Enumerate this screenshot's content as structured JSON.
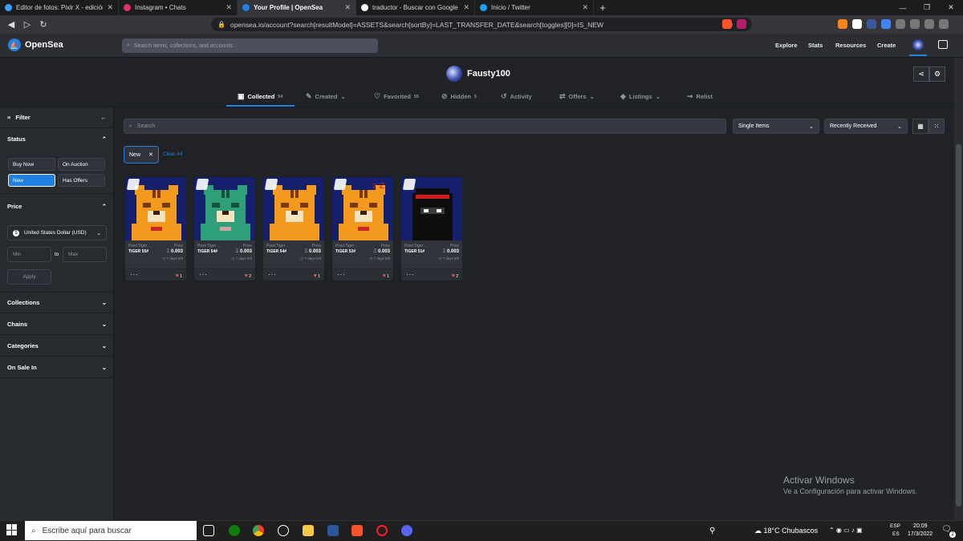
{
  "browser": {
    "tabs": [
      {
        "title": "Editor de fotos: Pixlr X - edición de im",
        "favicon_color": "#3aa0ff"
      },
      {
        "title": "Instagram • Chats",
        "favicon_color": "#e1306c"
      },
      {
        "title": "Your Profile | OpenSea",
        "favicon_color": "#2081e2",
        "active": true
      },
      {
        "title": "traductor - Buscar con Google",
        "favicon_color": "#ffffff"
      },
      {
        "title": "Inicio / Twitter",
        "favicon_color": "#1da1f2"
      }
    ],
    "url": "opensea.io/account?search[resultModel]=ASSETS&search[sortBy]=LAST_TRANSFER_DATE&search[toggles][0]=IS_NEW"
  },
  "header": {
    "brand": "OpenSea",
    "search_placeholder": "Search items, collections, and accounts",
    "nav": [
      "Explore",
      "Stats",
      "Resources",
      "Create"
    ]
  },
  "profile": {
    "name": "Fausty100",
    "tabs": [
      {
        "label": "Collected",
        "count": "54"
      },
      {
        "label": "Created",
        "count": ""
      },
      {
        "label": "Favorited",
        "count": "55"
      },
      {
        "label": "Hidden",
        "count": "5"
      },
      {
        "label": "Activity",
        "count": ""
      },
      {
        "label": "Offers",
        "count": ""
      },
      {
        "label": "Listings",
        "count": ""
      },
      {
        "label": "Relist",
        "count": ""
      }
    ]
  },
  "sidebar": {
    "filter_label": "Filter",
    "status_label": "Status",
    "status_buttons": [
      "Buy Now",
      "On Auction",
      "New",
      "Has Offers"
    ],
    "price_label": "Price",
    "currency": "United States Dollar (USD)",
    "min_placeholder": "Min",
    "to_label": "to",
    "max_placeholder": "Max",
    "apply_label": "Apply",
    "sections": [
      "Collections",
      "Chains",
      "Categories",
      "On Sale In"
    ]
  },
  "main": {
    "search_placeholder": "Search",
    "item_type": "Single Items",
    "sort": "Recently Received",
    "active_filter": "New",
    "clear_all": "Clear All",
    "cards": [
      {
        "collection": "Pixel Tiger ...",
        "name": "TIGER 55#",
        "price_label": "Price",
        "price": "0.003",
        "time_left": "7 days left",
        "likes": "1",
        "art": "tiger-red"
      },
      {
        "collection": "Pixel Tiger ...",
        "name": "TIGER 54#",
        "price_label": "Price",
        "price": "0.003",
        "time_left": "7 days left",
        "likes": "2",
        "art": "tiger-green"
      },
      {
        "collection": "Pixel Tiger ...",
        "name": "TIGER 54#",
        "price_label": "Price",
        "price": "0.003",
        "time_left": "7 days left",
        "likes": "1",
        "art": "tiger-orange"
      },
      {
        "collection": "Pixel Tiger ...",
        "name": "TIGER 52#",
        "price_label": "Price",
        "price": "0.003",
        "time_left": "7 days left",
        "likes": "1",
        "art": "tiger-sleep"
      },
      {
        "collection": "Pixel Tiger ...",
        "name": "TIGER 51#",
        "price_label": "Price",
        "price": "0.003",
        "time_left": "7 days left",
        "likes": "2",
        "art": "ninja"
      }
    ]
  },
  "watermark": {
    "line1": "Activar Windows",
    "line2": "Ve a Configuración para activar Windows."
  },
  "taskbar": {
    "search_placeholder": "Escribe aquí para buscar",
    "weather": "18°C  Chubascos",
    "lang": "ESP",
    "lang_sub": "ES",
    "time": "20:09",
    "date": "17/3/2022",
    "notifications": "2"
  },
  "colors": {
    "accent": "#2081e2",
    "like": "#eb5757",
    "card_bg": "#303339",
    "sidebar_bg": "#262b2f",
    "page_bg": "#202225"
  }
}
